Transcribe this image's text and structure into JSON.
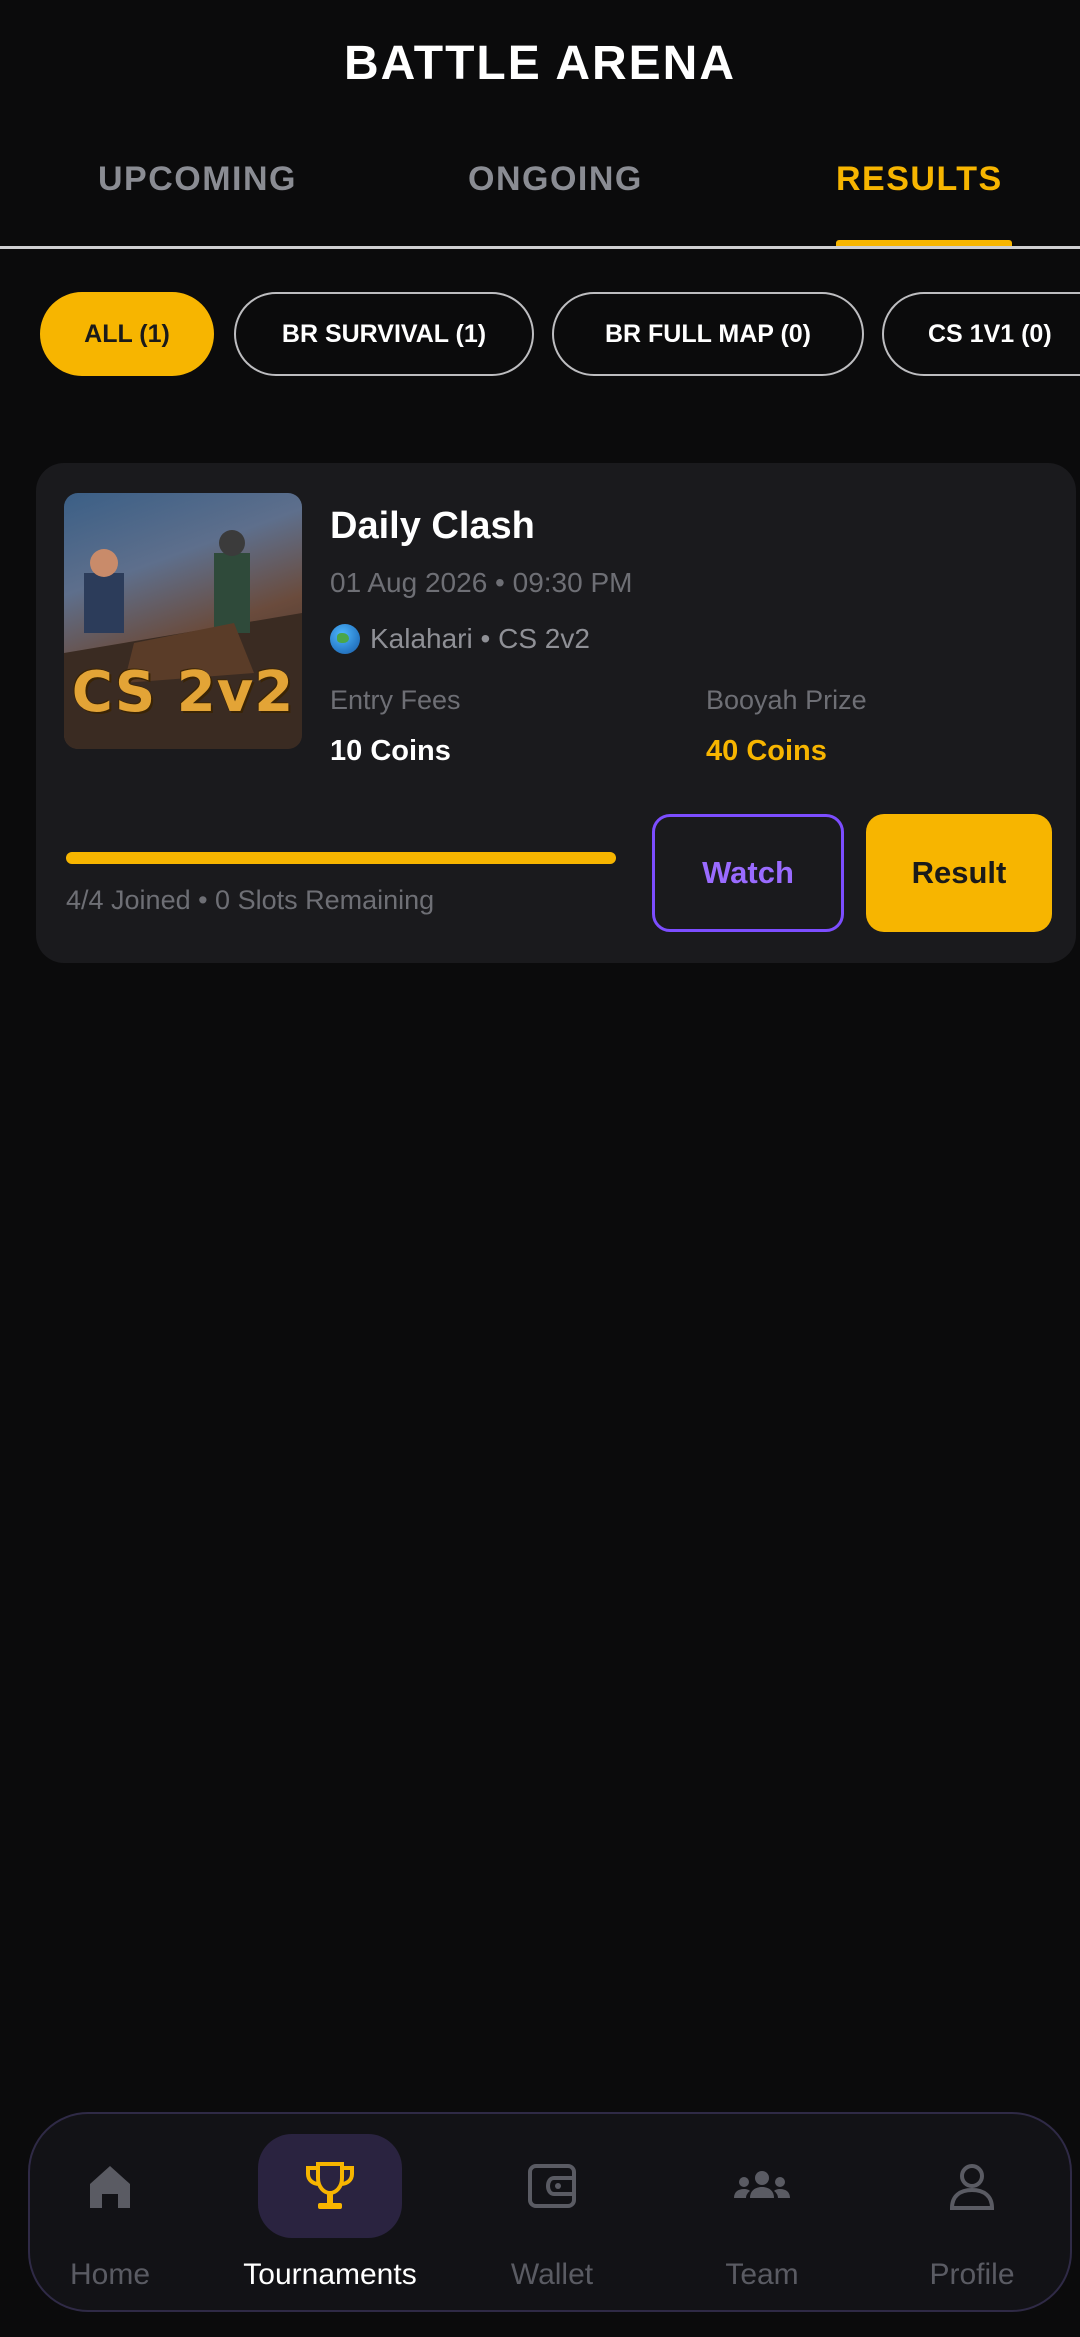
{
  "header": {
    "title": "BATTLE ARENA"
  },
  "tabs": [
    {
      "label": "UPCOMING",
      "active": false
    },
    {
      "label": "ONGOING",
      "active": false
    },
    {
      "label": "RESULTS",
      "active": true
    }
  ],
  "filters": [
    {
      "label": "ALL (1)",
      "active": true
    },
    {
      "label": "BR SURVIVAL  (1)",
      "active": false
    },
    {
      "label": "BR FULL MAP  (0)",
      "active": false
    },
    {
      "label": "CS 1V1  (0)",
      "active": false
    }
  ],
  "tournament": {
    "thumbnail_label": "CS 2v2",
    "title": "Daily Clash",
    "datetime": "01 Aug 2026 • 09:30 PM",
    "map_mode": "Kalahari • CS 2v2",
    "entry_label": "Entry Fees",
    "entry_value": "10 Coins",
    "prize_label": "Booyah Prize",
    "prize_value": "40 Coins",
    "progress_fraction": 1.0,
    "joined_text": "4/4 Joined  •  0 Slots Remaining",
    "watch_label": "Watch",
    "result_label": "Result"
  },
  "nav": [
    {
      "label": "Home",
      "icon": "home-icon",
      "active": false
    },
    {
      "label": "Tournaments",
      "icon": "trophy-icon",
      "active": true
    },
    {
      "label": "Wallet",
      "icon": "wallet-icon",
      "active": false
    },
    {
      "label": "Team",
      "icon": "team-icon",
      "active": false
    },
    {
      "label": "Profile",
      "icon": "profile-icon",
      "active": false
    }
  ],
  "colors": {
    "background": "#0b0b0c",
    "accent": "#f7b500",
    "purple": "#7c4dff",
    "card": "#1a1a1d"
  }
}
